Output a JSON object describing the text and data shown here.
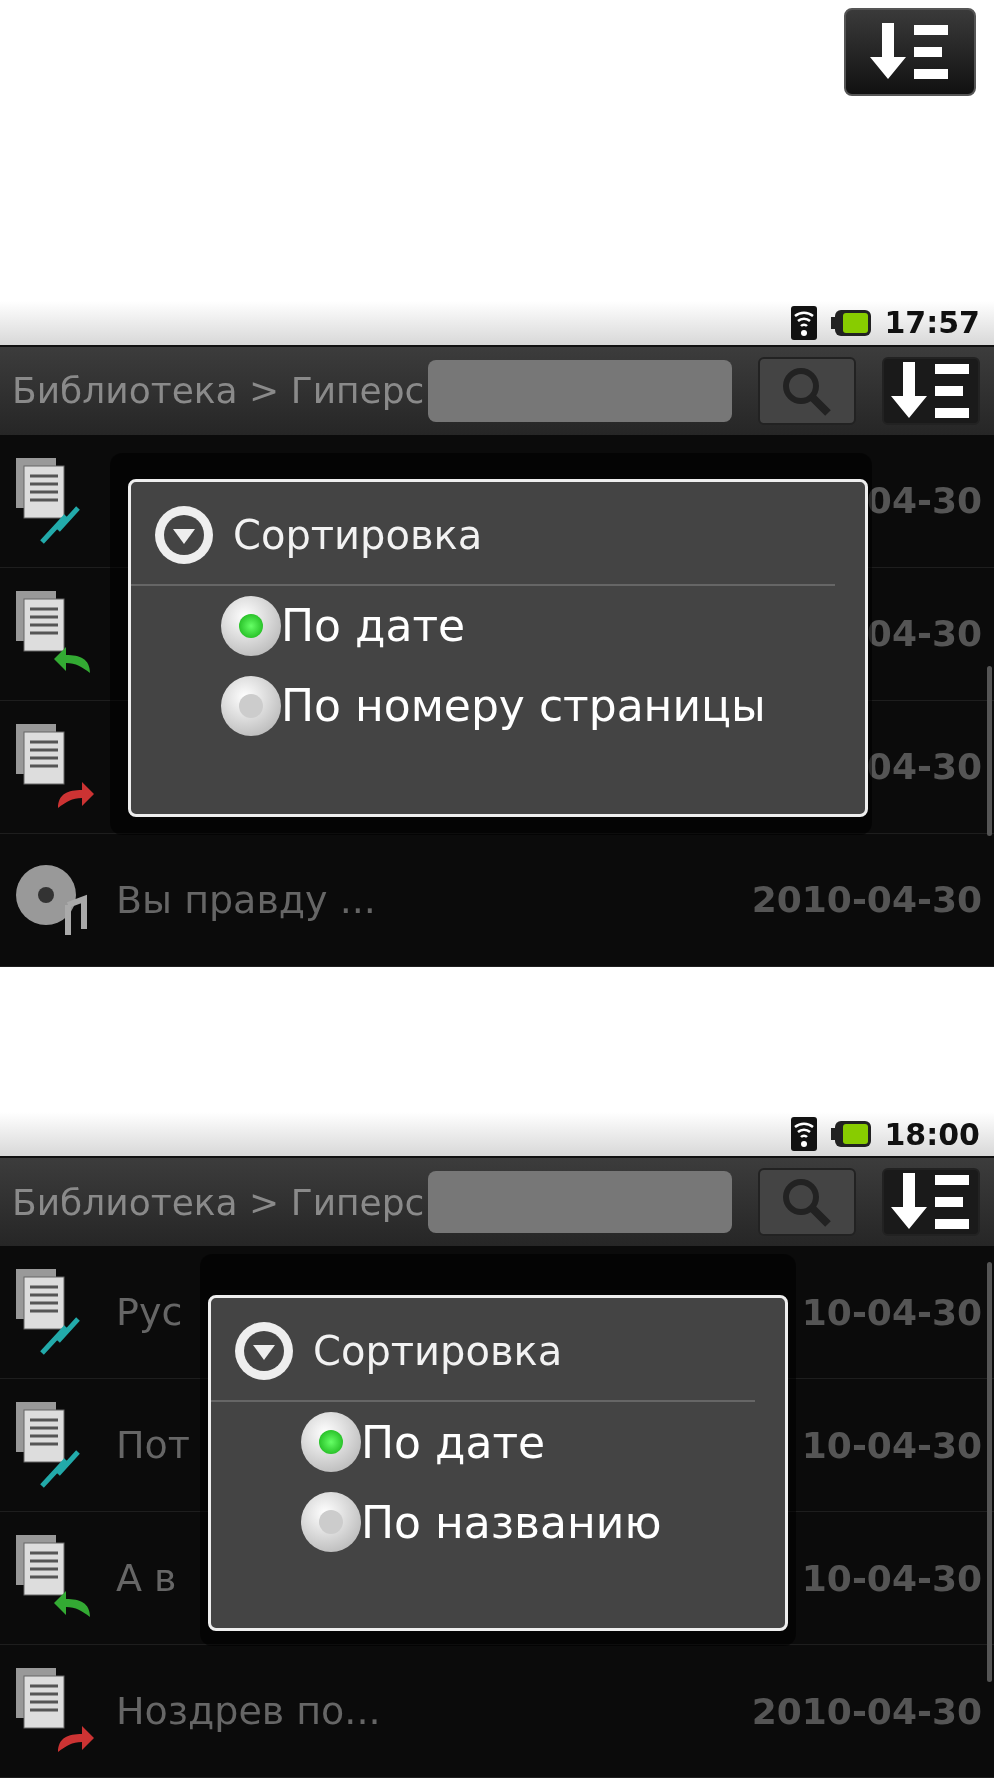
{
  "screens": [
    {
      "status_time": "17:57",
      "breadcrumb": "Библиотека > Гиперс",
      "rows": [
        {
          "kind": "link",
          "date": "04-30"
        },
        {
          "kind": "back",
          "date": "04-30"
        },
        {
          "kind": "forward",
          "date": "04-30"
        },
        {
          "kind": "audio",
          "title": "Вы правду ...",
          "date": "2010-04-30"
        }
      ],
      "dialog": {
        "title": "Сортировка",
        "options": [
          {
            "label": "По дате",
            "selected": true
          },
          {
            "label": "По номеру страницы",
            "selected": false
          }
        ]
      }
    },
    {
      "status_time": "18:00",
      "breadcrumb": "Библиотека > Гиперс",
      "rows": [
        {
          "kind": "link",
          "title": "Рус",
          "date": "10-04-30"
        },
        {
          "kind": "link",
          "title": "Пот",
          "date": "10-04-30"
        },
        {
          "kind": "back",
          "title": "А в",
          "date": "10-04-30"
        },
        {
          "kind": "forward",
          "title": "Ноздрев по...",
          "date": "2010-04-30"
        }
      ],
      "dialog": {
        "title": "Сортировка",
        "options": [
          {
            "label": "По дате",
            "selected": true
          },
          {
            "label": "По названию",
            "selected": false
          }
        ]
      }
    }
  ]
}
